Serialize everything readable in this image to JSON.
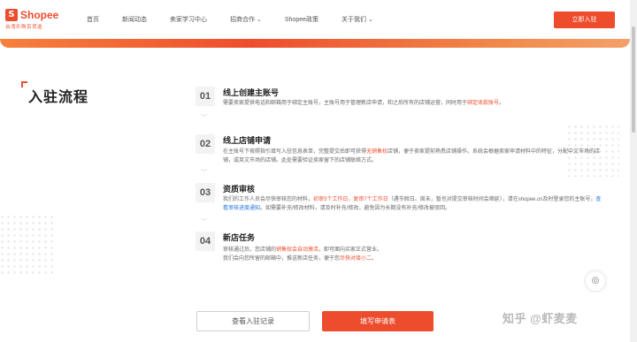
{
  "header": {
    "logo_mark": "S",
    "logo_text": "Shopee",
    "logo_sub": "台湾乐购百货选",
    "nav": [
      {
        "label": "首页",
        "dropdown": false
      },
      {
        "label": "新闻动态",
        "dropdown": false
      },
      {
        "label": "卖家学习中心",
        "dropdown": false
      },
      {
        "label": "招商合作",
        "dropdown": true
      },
      {
        "label": "Shopee政策",
        "dropdown": false
      },
      {
        "label": "关于我们",
        "dropdown": true
      }
    ],
    "join_button": "立即入驻"
  },
  "section": {
    "title": "入驻流程"
  },
  "steps": [
    {
      "number": "01",
      "title": "线上创建主账号",
      "desc_before": "需要卖家提供电话和邮箱用于绑定主账号，主账号用于管理新店申请，和之后所有的店铺运营，同时用于",
      "desc_highlight": "绑定收款账号",
      "desc_after": "。"
    },
    {
      "number": "02",
      "title": "线上店铺申请",
      "desc_before": "在主账号下按照指引填写入驻信息表单，完整提交后即可获得",
      "desc_highlight": "无销售权",
      "desc_after": "店铺，便于卖家提前熟悉店铺操作。系统会根据卖家申请材料中的特征，分配中文市场的店铺，或英文市场的店铺。此处需要验证卖家留下的店铺联络方式。"
    },
    {
      "number": "03",
      "title": "资质审核",
      "desc_part1": "我们的工作人员会尽快审核您的材料，",
      "desc_hl1": "初审5个工作日，复审7个工作日",
      "desc_part2": "（遇节假日、周末，暂也对提交审核时间会顺延），请在shopee.cn及时登录您的主账号，",
      "desc_hl2": "查看审核进度通知",
      "desc_part3": "。如需要补充/修改材料，请及时补充/修改，避免因为长期没有补充/修改被驳回。"
    },
    {
      "number": "04",
      "title": "新店任务",
      "desc_part1": "审核通过后，您店铺的",
      "desc_hl1": "销售权会自动激活",
      "desc_part2": "，即可面向买家正式营业。",
      "desc_line2_before": "我们会向您所留的邮箱中，推送新店任务，便于您",
      "desc_line2_highlight": "尽快对接小二",
      "desc_line2_after": "。"
    }
  ],
  "buttons": {
    "records": "查看入驻记录",
    "apply": "填写申请表"
  },
  "float_icon": "headset-icon",
  "watermark": "知乎 @虾麦麦",
  "colors": {
    "brand": "#ee4d2d",
    "link": "#2673dd"
  }
}
